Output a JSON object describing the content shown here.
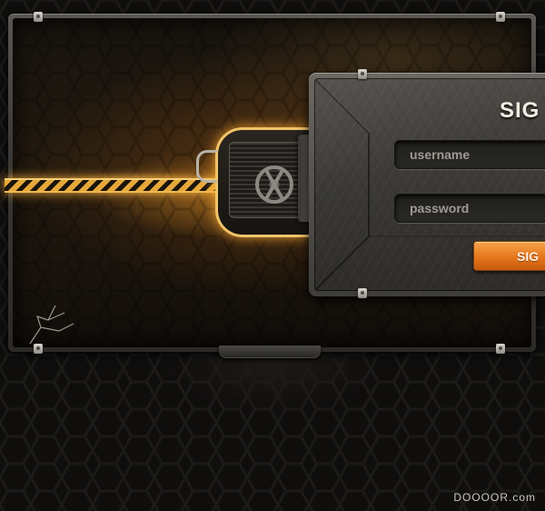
{
  "login": {
    "title": "SIG",
    "username_placeholder": "username",
    "password_placeholder": "password",
    "submit_label": "SIG"
  },
  "footer": {
    "watermark": "DOOOOR.com"
  },
  "colors": {
    "accent": "#e5761b",
    "glow": "#f2c46a",
    "background": "#0f0e0d"
  },
  "icons": [
    "bolt-icon",
    "valve-wheel-icon",
    "hook-icon"
  ]
}
